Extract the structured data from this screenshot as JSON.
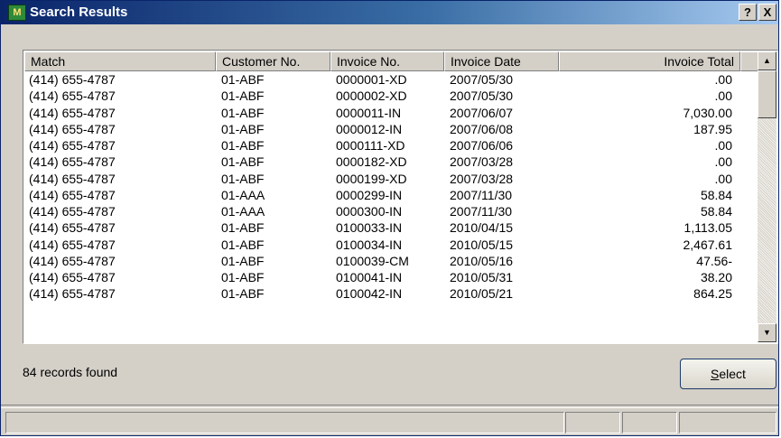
{
  "window": {
    "title": "Search Results",
    "icon_name": "app-icon-mas90",
    "help_label": "?",
    "close_label": "X"
  },
  "table": {
    "columns": [
      "Match",
      "Customer No.",
      "Invoice No.",
      "Invoice Date",
      "Invoice Total"
    ],
    "rows": [
      {
        "match": "(414) 655-4787",
        "customer": "01-ABF",
        "invoice": "0000001-XD",
        "date": "2007/05/30",
        "total": ".00"
      },
      {
        "match": "(414) 655-4787",
        "customer": "01-ABF",
        "invoice": "0000002-XD",
        "date": "2007/05/30",
        "total": ".00"
      },
      {
        "match": "(414) 655-4787",
        "customer": "01-ABF",
        "invoice": "0000011-IN",
        "date": "2007/06/07",
        "total": "7,030.00"
      },
      {
        "match": "(414) 655-4787",
        "customer": "01-ABF",
        "invoice": "0000012-IN",
        "date": "2007/06/08",
        "total": "187.95"
      },
      {
        "match": "(414) 655-4787",
        "customer": "01-ABF",
        "invoice": "0000111-XD",
        "date": "2007/06/06",
        "total": ".00"
      },
      {
        "match": "(414) 655-4787",
        "customer": "01-ABF",
        "invoice": "0000182-XD",
        "date": "2007/03/28",
        "total": ".00"
      },
      {
        "match": "(414) 655-4787",
        "customer": "01-ABF",
        "invoice": "0000199-XD",
        "date": "2007/03/28",
        "total": ".00"
      },
      {
        "match": "(414) 655-4787",
        "customer": "01-AAA",
        "invoice": "0000299-IN",
        "date": "2007/11/30",
        "total": "58.84"
      },
      {
        "match": "(414) 655-4787",
        "customer": "01-AAA",
        "invoice": "0000300-IN",
        "date": "2007/11/30",
        "total": "58.84"
      },
      {
        "match": "(414) 655-4787",
        "customer": "01-ABF",
        "invoice": "0100033-IN",
        "date": "2010/04/15",
        "total": "1,113.05"
      },
      {
        "match": "(414) 655-4787",
        "customer": "01-ABF",
        "invoice": "0100034-IN",
        "date": "2010/05/15",
        "total": "2,467.61"
      },
      {
        "match": "(414) 655-4787",
        "customer": "01-ABF",
        "invoice": "0100039-CM",
        "date": "2010/05/16",
        "total": "47.56-"
      },
      {
        "match": "(414) 655-4787",
        "customer": "01-ABF",
        "invoice": "0100041-IN",
        "date": "2010/05/31",
        "total": "38.20"
      },
      {
        "match": "(414) 655-4787",
        "customer": "01-ABF",
        "invoice": "0100042-IN",
        "date": "2010/05/21",
        "total": "864.25"
      }
    ]
  },
  "scrollbar": {
    "up_icon": "scroll-up-arrow-icon",
    "down_icon": "scroll-down-arrow-icon"
  },
  "footer": {
    "records_text": "84 records found",
    "select_label": "Select"
  }
}
